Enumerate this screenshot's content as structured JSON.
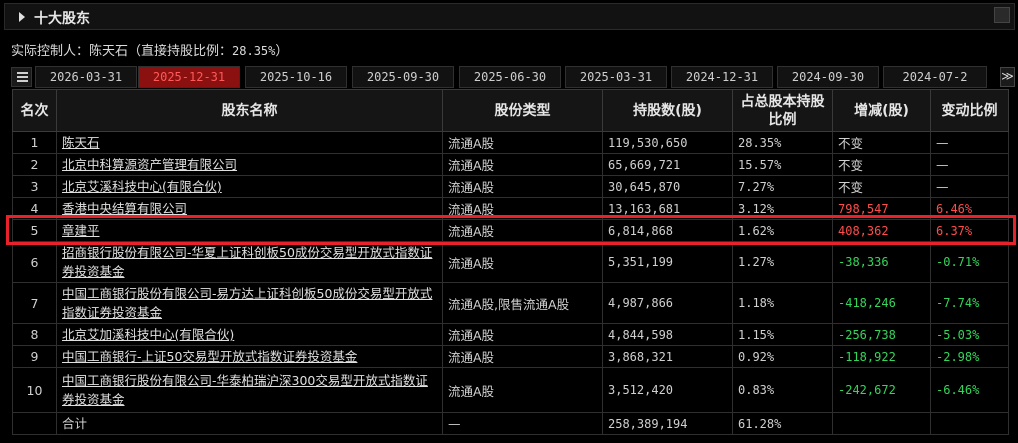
{
  "section": {
    "title": "十大股东"
  },
  "controller": {
    "label": "实际控制人：陈天石（直接持股比例：",
    "pct": "28.35%",
    "close": "）"
  },
  "tabs": [
    "2026-03-31",
    "2025-12-31",
    "2025-10-16",
    "2025-09-30",
    "2025-06-30",
    "2025-03-31",
    "2024-12-31",
    "2024-09-30",
    "2024-07-2"
  ],
  "active_tab": "2025-12-31",
  "scroll_label": "≫",
  "table": {
    "headers": [
      "名次",
      "股东名称",
      "股份类型",
      "持股数(股)",
      "占总股本持股比例",
      "增减(股)",
      "变动比例"
    ],
    "rows": [
      {
        "rank": "1",
        "name": "陈天石",
        "type": "流通A股",
        "shares": "119,530,650",
        "ratio": "28.35%",
        "change": "不变",
        "change_pct": "—",
        "dir": "flat"
      },
      {
        "rank": "2",
        "name": "北京中科算源资产管理有限公司",
        "type": "流通A股",
        "shares": "65,669,721",
        "ratio": "15.57%",
        "change": "不变",
        "change_pct": "—",
        "dir": "flat"
      },
      {
        "rank": "3",
        "name": "北京艾溪科技中心(有限合伙)",
        "type": "流通A股",
        "shares": "30,645,870",
        "ratio": "7.27%",
        "change": "不变",
        "change_pct": "—",
        "dir": "flat"
      },
      {
        "rank": "4",
        "name": "香港中央结算有限公司",
        "type": "流通A股",
        "shares": "13,163,681",
        "ratio": "3.12%",
        "change": "798,547",
        "change_pct": "6.46%",
        "dir": "up"
      },
      {
        "rank": "5",
        "name": "章建平",
        "type": "流通A股",
        "shares": "6,814,868",
        "ratio": "1.62%",
        "change": "408,362",
        "change_pct": "6.37%",
        "dir": "up"
      },
      {
        "rank": "6",
        "name": "招商银行股份有限公司-华夏上证科创板50成份交易型开放式指数证券投资基金",
        "type": "流通A股",
        "shares": "5,351,199",
        "ratio": "1.27%",
        "change": "-38,336",
        "change_pct": "-0.71%",
        "dir": "down"
      },
      {
        "rank": "7",
        "name": "中国工商银行股份有限公司-易方达上证科创板50成份交易型开放式指数证券投资基金",
        "type": "流通A股,限售流通A股",
        "shares": "4,987,866",
        "ratio": "1.18%",
        "change": "-418,246",
        "change_pct": "-7.74%",
        "dir": "down"
      },
      {
        "rank": "8",
        "name": "北京艾加溪科技中心(有限合伙)",
        "type": "流通A股",
        "shares": "4,844,598",
        "ratio": "1.15%",
        "change": "-256,738",
        "change_pct": "-5.03%",
        "dir": "down"
      },
      {
        "rank": "9",
        "name": "中国工商银行-上证50交易型开放式指数证券投资基金",
        "type": "流通A股",
        "shares": "3,868,321",
        "ratio": "0.92%",
        "change": "-118,922",
        "change_pct": "-2.98%",
        "dir": "down"
      },
      {
        "rank": "10",
        "name": "中国工商银行股份有限公司-华泰柏瑞沪深300交易型开放式指数证券投资基金",
        "type": "流通A股",
        "shares": "3,512,420",
        "ratio": "0.83%",
        "change": "-242,672",
        "change_pct": "-6.46%",
        "dir": "down"
      }
    ],
    "total": {
      "label": "合计",
      "type": "—",
      "shares": "258,389,194",
      "ratio": "61.28%",
      "change": "",
      "change_pct": ""
    }
  },
  "colors": {
    "up": "#ff4d4d",
    "down": "#33d65a",
    "active_tab_bg": "#8b1010",
    "highlight": "#e8222a"
  }
}
